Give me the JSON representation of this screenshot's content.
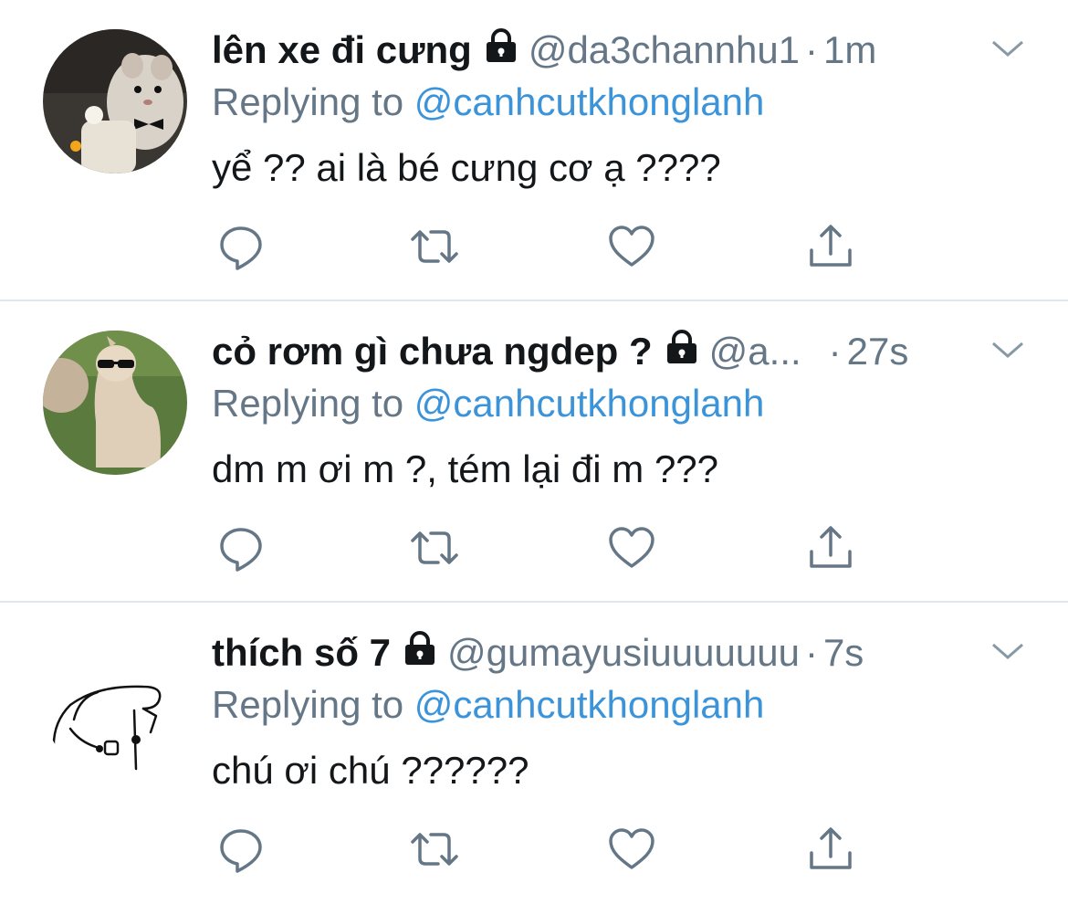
{
  "colors": {
    "text": "#14171a",
    "secondary": "#657786",
    "link": "#3b94d9",
    "divider": "#e1e8ed"
  },
  "tweets": [
    {
      "display_name": "lên xe đi cưng",
      "handle": "@da3channhu1",
      "separator": "·",
      "time": "1m",
      "replying_prefix": "Replying to",
      "replying_to": "@canhcutkhonglanh",
      "text": "yể ?? ai là bé cưng cơ ạ ????",
      "avatar": "hamster-avatar",
      "locked": true
    },
    {
      "display_name": "cỏ rơm gì chưa ngdep ?",
      "handle": "@a...",
      "separator": "·",
      "time": "27s",
      "replying_prefix": "Replying to",
      "replying_to": "@canhcutkhonglanh",
      "text": "dm m ơi m ?, tém lại đi m ???",
      "avatar": "alpaca-sunglasses-avatar",
      "locked": true
    },
    {
      "display_name": "thích số 7",
      "handle": "@gumayusiuuuuuuu",
      "separator": "·",
      "time": "7s",
      "replying_prefix": "Replying to",
      "replying_to": "@canhcutkhonglanh",
      "text": "chú ơi chú ??????",
      "avatar": "doodle-blob-avatar",
      "locked": true
    }
  ],
  "action_icons": [
    "reply-icon",
    "retweet-icon",
    "like-icon",
    "share-icon"
  ]
}
